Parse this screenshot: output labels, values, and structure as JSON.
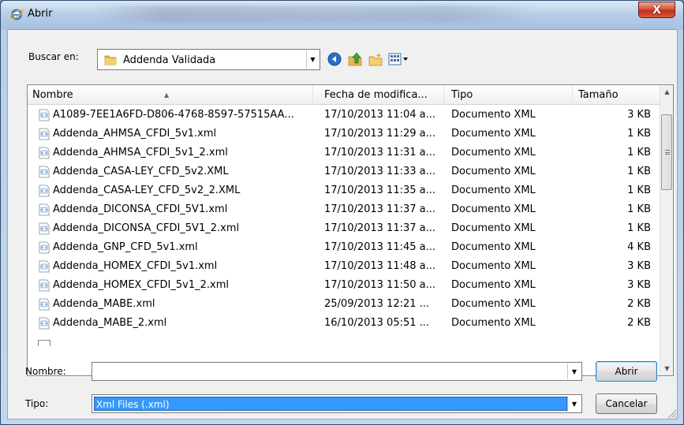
{
  "window": {
    "title": "Abrir",
    "close_glyph": "X",
    "icon": "ie-icon"
  },
  "lookin": {
    "label": "Buscar en:",
    "value": "Addenda Validada",
    "icon": "folder-icon"
  },
  "toolbar": {
    "buttons": [
      "back-icon",
      "up-folder-icon",
      "new-folder-icon",
      "views-menu-icon"
    ]
  },
  "list": {
    "columns": [
      "Nombre",
      "Fecha de modifica...",
      "Tipo",
      "Tamaño"
    ],
    "rows": [
      {
        "name": "A1089-7EE1A6FD-D806-4768-8597-57515AA...",
        "date": "17/10/2013 11:04 a...",
        "type": "Documento XML",
        "size": "3 KB"
      },
      {
        "name": "Addenda_AHMSA_CFDI_5v1.xml",
        "date": "17/10/2013 11:29 a...",
        "type": "Documento XML",
        "size": "1 KB"
      },
      {
        "name": "Addenda_AHMSA_CFDI_5v1_2.xml",
        "date": "17/10/2013 11:31 a...",
        "type": "Documento XML",
        "size": "1 KB"
      },
      {
        "name": "Addenda_CASA-LEY_CFD_5v2.XML",
        "date": "17/10/2013 11:33 a...",
        "type": "Documento XML",
        "size": "1 KB"
      },
      {
        "name": "Addenda_CASA-LEY_CFD_5v2_2.XML",
        "date": "17/10/2013 11:35 a...",
        "type": "Documento XML",
        "size": "1 KB"
      },
      {
        "name": "Addenda_DICONSA_CFDI_5V1.xml",
        "date": "17/10/2013 11:37 a...",
        "type": "Documento XML",
        "size": "1 KB"
      },
      {
        "name": "Addenda_DICONSA_CFDI_5V1_2.xml",
        "date": "17/10/2013 11:37 a...",
        "type": "Documento XML",
        "size": "1 KB"
      },
      {
        "name": "Addenda_GNP_CFD_5v1.xml",
        "date": "17/10/2013 11:45 a...",
        "type": "Documento XML",
        "size": "4 KB"
      },
      {
        "name": "Addenda_HOMEX_CFDI_5v1.xml",
        "date": "17/10/2013 11:48 a...",
        "type": "Documento XML",
        "size": "3 KB"
      },
      {
        "name": "Addenda_HOMEX_CFDI_5v1_2.xml",
        "date": "17/10/2013 11:50 a...",
        "type": "Documento XML",
        "size": "3 KB"
      },
      {
        "name": "Addenda_MABE.xml",
        "date": "25/09/2013 12:21 ...",
        "type": "Documento XML",
        "size": "2 KB"
      },
      {
        "name": "Addenda_MABE_2.xml",
        "date": "16/10/2013 05:51 ...",
        "type": "Documento XML",
        "size": "2 KB"
      }
    ]
  },
  "filename": {
    "label": "Nombre:",
    "value": ""
  },
  "filetype": {
    "label": "Tipo:",
    "value": "Xml Files (.xml)"
  },
  "buttons": {
    "open": "Abrir",
    "cancel": "Cancelar"
  },
  "colors": {
    "selection": "#3399ff",
    "close_red": "#c1301a"
  }
}
